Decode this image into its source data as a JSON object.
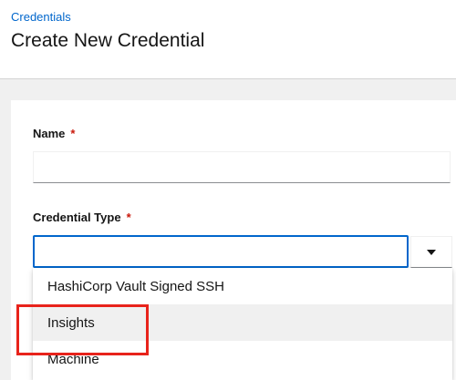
{
  "header": {
    "breadcrumb": "Credentials",
    "title": "Create New Credential"
  },
  "form": {
    "name_label": "Name",
    "name_required": "*",
    "name_value": "",
    "type_label": "Credential Type",
    "type_required": "*",
    "type_value": ""
  },
  "dropdown": {
    "options": [
      {
        "label": "HashiCorp Vault Signed SSH"
      },
      {
        "label": "Insights",
        "hovered": true
      },
      {
        "label": "Machine"
      }
    ]
  },
  "colors": {
    "link": "#0066cc",
    "required": "#c9190b",
    "focus_border": "#0066cc",
    "highlight_box": "#e8231b"
  },
  "icons": {
    "toggle": "caret-down-icon"
  }
}
